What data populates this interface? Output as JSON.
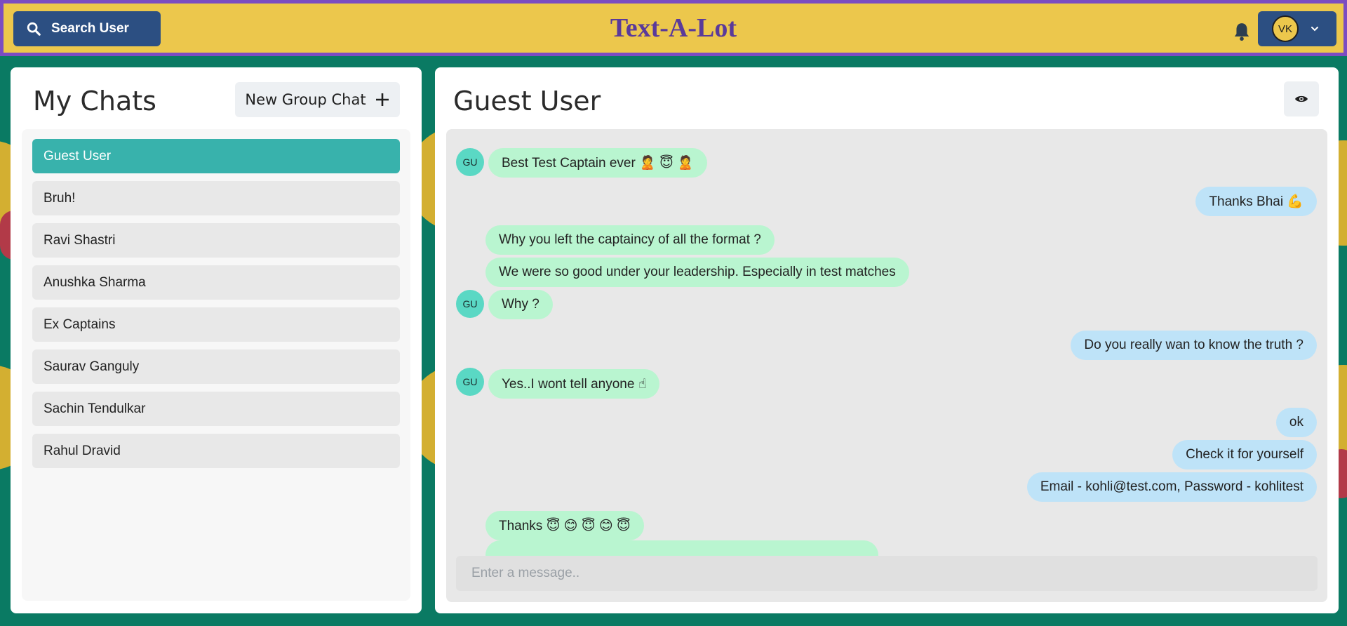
{
  "header": {
    "search_label": "Search User",
    "app_title": "Text-A-Lot",
    "profile_initials": "VK"
  },
  "sidebar": {
    "title": "My Chats",
    "new_group_label": "New Group Chat",
    "chats": [
      {
        "name": "Guest User",
        "active": true
      },
      {
        "name": "Bruh!",
        "active": false
      },
      {
        "name": "Ravi Shastri",
        "active": false
      },
      {
        "name": "Anushka Sharma",
        "active": false
      },
      {
        "name": "Ex Captains",
        "active": false
      },
      {
        "name": "Saurav Ganguly",
        "active": false
      },
      {
        "name": "Sachin Tendulkar",
        "active": false
      },
      {
        "name": "Rahul Dravid",
        "active": false
      }
    ]
  },
  "chat": {
    "title": "Guest User",
    "avatar_initials": "GU",
    "messages": [
      {
        "dir": "in",
        "text": "Best Test Captain ever 🙎 😇 🙎",
        "avatar": true
      },
      {
        "dir": "out",
        "text": "Thanks Bhai 💪"
      },
      {
        "dir": "in",
        "text": "Why you left the captaincy of all the format ?",
        "avatar": false
      },
      {
        "dir": "in",
        "text": "We were so good under your leadership. Especially in test matches",
        "avatar": false
      },
      {
        "dir": "in",
        "text": "Why ?",
        "avatar": true
      },
      {
        "dir": "out",
        "text": "Do you really wan to know the truth ?"
      },
      {
        "dir": "in",
        "text": "Yes..I wont tell anyone ☝",
        "avatar": true
      },
      {
        "dir": "out",
        "text": "ok"
      },
      {
        "dir": "out",
        "text": "Check it for yourself"
      },
      {
        "dir": "out",
        "text": "Email - kohli@test.com, Password - kohlitest"
      },
      {
        "dir": "in",
        "text": "Thanks 😇 😊 😇 😊 😇",
        "avatar": false
      }
    ],
    "input_placeholder": "Enter a message.."
  },
  "colors": {
    "header_bg": "#ecc74c",
    "header_border": "#7b4cc2",
    "accent_button": "#2c4f82",
    "active_chat": "#38b2ac",
    "incoming_bubble": "#b9f5d0",
    "outgoing_bubble": "#bee3f8"
  },
  "icons": {
    "search": "search-icon",
    "bell": "bell-icon",
    "chevron": "chevron-down-icon",
    "plus": "plus-icon",
    "eye": "eye-icon"
  }
}
